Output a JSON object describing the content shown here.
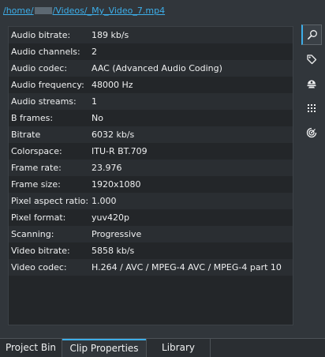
{
  "path": {
    "prefix": "/home/",
    "suffix": "/Videos/_My_Video_7.mp4"
  },
  "properties": [
    {
      "label": "Audio bitrate:",
      "value": "189 kb/s"
    },
    {
      "label": "Audio channels:",
      "value": "2"
    },
    {
      "label": "Audio codec:",
      "value": "AAC (Advanced Audio Coding)"
    },
    {
      "label": "Audio frequency:",
      "value": "48000 Hz"
    },
    {
      "label": "Audio streams:",
      "value": "1"
    },
    {
      "label": "B frames:",
      "value": "No"
    },
    {
      "label": "Bitrate",
      "value": "6032 kb/s"
    },
    {
      "label": "Colorspace:",
      "value": "ITU-R BT.709"
    },
    {
      "label": "Frame rate:",
      "value": "23.976"
    },
    {
      "label": "Frame size:",
      "value": "1920x1080"
    },
    {
      "label": "Pixel aspect ratio:",
      "value": "1.000"
    },
    {
      "label": "Pixel format:",
      "value": "yuv420p"
    },
    {
      "label": "Scanning:",
      "value": "Progressive"
    },
    {
      "label": "Video bitrate:",
      "value": "5858 kb/s"
    },
    {
      "label": "Video codec:",
      "value": "H.264 / AVC / MPEG-4 AVC / MPEG-4 part 10"
    }
  ],
  "side_toolbar": [
    {
      "icon": "search-icon",
      "active": true
    },
    {
      "icon": "tag-icon",
      "active": false
    },
    {
      "icon": "webcam-icon",
      "active": false
    },
    {
      "icon": "grid-dots-icon",
      "active": false
    },
    {
      "icon": "audio-target-icon",
      "active": false
    }
  ],
  "tabs": [
    {
      "label": "Project Bin",
      "active": false
    },
    {
      "label": "Clip Properties",
      "active": true
    },
    {
      "label": "Library",
      "active": false
    }
  ],
  "colors": {
    "accent": "#3daee9",
    "background": "#31363b",
    "panel": "#232629",
    "text": "#eff0f1"
  }
}
